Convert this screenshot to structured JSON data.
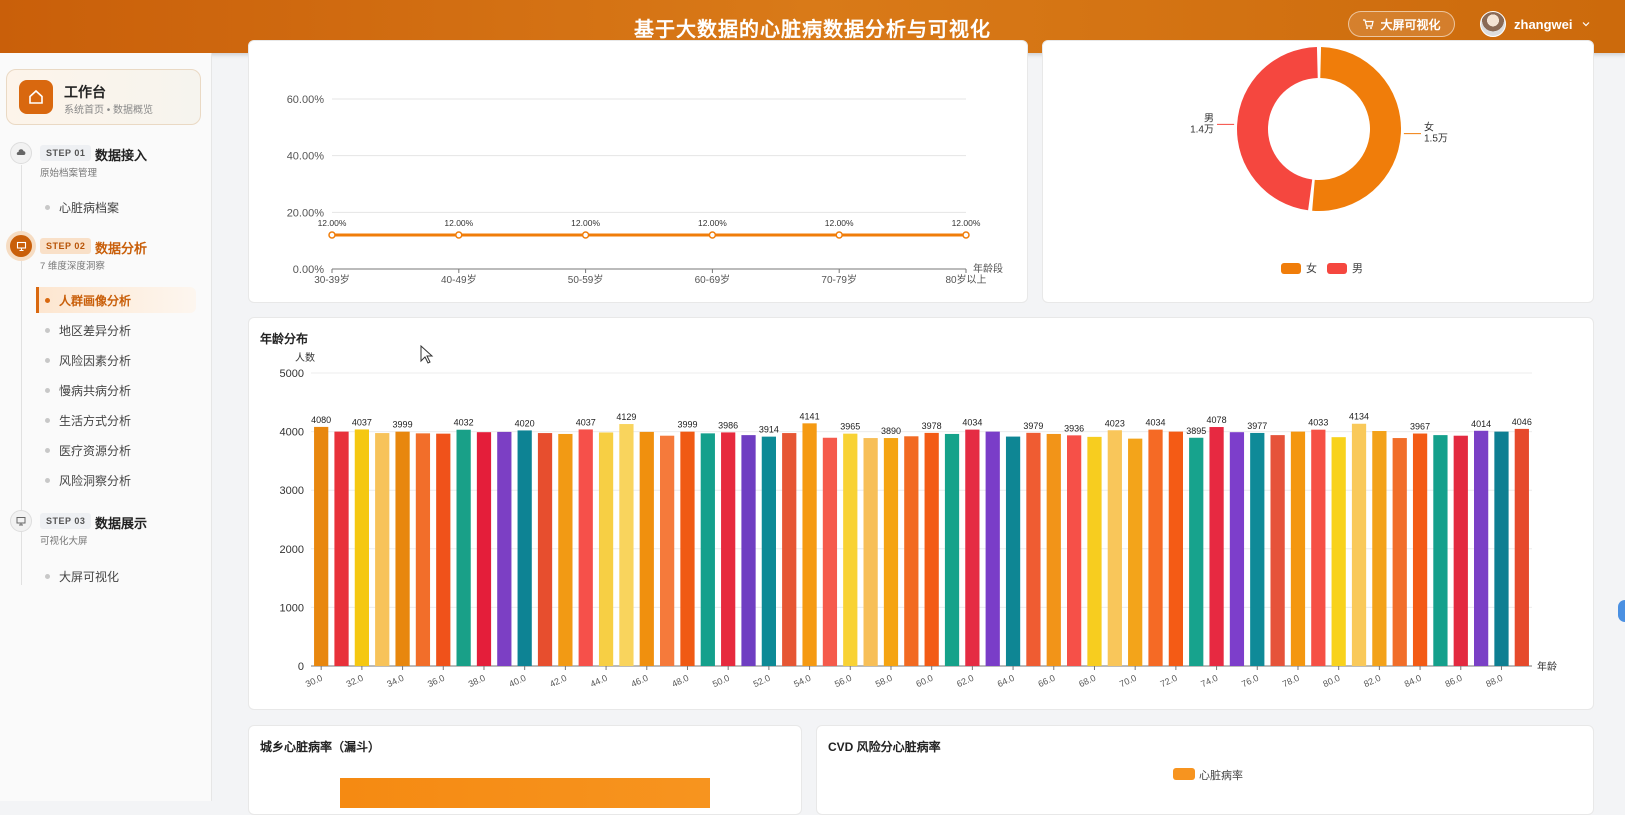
{
  "header": {
    "title": "基于大数据的心脏病数据分析与可视化",
    "bigscreen_label": "大屏可视化",
    "username": "zhangwei"
  },
  "sidebar": {
    "workbench": {
      "title": "工作台",
      "subtitle": "系统首页 • 数据概览"
    },
    "steps": [
      {
        "tag": "STEP 01",
        "name": "数据接入",
        "sub": "原始档案管理",
        "items": [
          "心脏病档案"
        ]
      },
      {
        "tag": "STEP 02",
        "name": "数据分析",
        "sub": "7 维度深度洞察",
        "items": [
          "人群画像分析",
          "地区差异分析",
          "风险因素分析",
          "慢病共病分析",
          "生活方式分析",
          "医疗资源分析",
          "风险洞察分析"
        ]
      },
      {
        "tag": "STEP 03",
        "name": "数据展示",
        "sub": "可视化大屏",
        "items": [
          "大屏可视化"
        ]
      }
    ]
  },
  "colors": {
    "accent": "#d9680f",
    "female": "#f07d0a",
    "male": "#f5473f"
  },
  "chart_data": [
    {
      "type": "line",
      "x": [
        "30-39岁",
        "40-49岁",
        "50-59岁",
        "60-69岁",
        "70-79岁",
        "80岁以上"
      ],
      "series": [
        {
          "values": [
            12.0,
            12.0,
            12.0,
            12.0,
            12.0,
            12.0
          ]
        }
      ],
      "data_labels": [
        "12.00%",
        "12.00%",
        "12.00%",
        "12.00%",
        "12.00%",
        "12.00%"
      ],
      "xlabel": "年龄段",
      "ylabel": "",
      "yticks": [
        "0.00%",
        "20.00%",
        "40.00%",
        "60.00%"
      ],
      "ylim": [
        0,
        60
      ],
      "grid": true
    },
    {
      "type": "pie",
      "donut": true,
      "labels": [
        "女",
        "男"
      ],
      "values": [
        1.5,
        1.4
      ],
      "value_labels": [
        "1.5万",
        "1.4万"
      ],
      "legend": "bottom"
    },
    {
      "type": "bar",
      "title": "年龄分布",
      "xlabel": "年龄",
      "ylabel": "人数",
      "ylim": [
        0,
        5000
      ],
      "yticks": [
        0,
        1000,
        2000,
        3000,
        4000,
        5000
      ],
      "categories": [
        "30.0",
        "31.0",
        "32.0",
        "33.0",
        "34.0",
        "35.0",
        "36.0",
        "37.0",
        "38.0",
        "39.0",
        "40.0",
        "41.0",
        "42.0",
        "43.0",
        "44.0",
        "45.0",
        "46.0",
        "47.0",
        "48.0",
        "49.0",
        "50.0",
        "51.0",
        "52.0",
        "53.0",
        "54.0",
        "55.0",
        "56.0",
        "57.0",
        "58.0",
        "59.0",
        "60.0",
        "61.0",
        "62.0",
        "63.0",
        "64.0",
        "65.0",
        "66.0",
        "67.0",
        "68.0",
        "69.0",
        "70.0",
        "71.0",
        "72.0",
        "73.0",
        "74.0",
        "75.0",
        "76.0",
        "77.0",
        "78.0",
        "79.0",
        "80.0",
        "81.0",
        "82.0",
        "83.0",
        "84.0",
        "85.0",
        "86.0",
        "87.0",
        "88.0",
        "89.0"
      ],
      "tick_labels": [
        "30.0",
        "32.0",
        "34.0",
        "36.0",
        "38.0",
        "40.0",
        "42.0",
        "44.0",
        "46.0",
        "48.0",
        "50.0",
        "52.0",
        "54.0",
        "56.0",
        "58.0",
        "60.0",
        "62.0",
        "64.0",
        "66.0",
        "68.0",
        "70.0",
        "72.0",
        "74.0",
        "76.0",
        "78.0",
        "80.0",
        "82.0",
        "84.0",
        "86.0",
        "88.0"
      ],
      "values": [
        4080,
        4000,
        4037,
        3975,
        3999,
        3970,
        3965,
        4032,
        3990,
        3995,
        4020,
        3975,
        3960,
        4037,
        3985,
        4129,
        3995,
        3930,
        3999,
        3970,
        3986,
        3940,
        3914,
        3975,
        4141,
        3895,
        3965,
        3890,
        3890,
        3920,
        3978,
        3960,
        4034,
        4000,
        3915,
        3979,
        3960,
        3936,
        3910,
        4023,
        3880,
        4034,
        4000,
        3895,
        4078,
        3990,
        3977,
        3940,
        4000,
        4033,
        3905,
        4134,
        4010,
        3890,
        3967,
        3940,
        3930,
        4014,
        4000,
        4046
      ],
      "label_values": {
        "0": 4080,
        "2": 4037,
        "4": 3999,
        "7": 4032,
        "10": 4020,
        "13": 4037,
        "15": 4129,
        "18": 3999,
        "20": 3986,
        "22": 3914,
        "24": 4141,
        "26": 3965,
        "28": 3890,
        "30": 3978,
        "32": 4034,
        "35": 3979,
        "37": 3936,
        "39": 4023,
        "41": 4034,
        "43": 3895,
        "44": 4078,
        "46": 3977,
        "49": 4033,
        "51": 4134,
        "54": 3967,
        "57": 4014,
        "59": 4046
      },
      "bar_colors": [
        "#e8870e",
        "#e8313b",
        "#f5c811",
        "#f7c35a",
        "#e8870e",
        "#f26e2a",
        "#f0521a",
        "#19a088",
        "#e41e3a",
        "#7c3fc4",
        "#0d8394",
        "#e74e2e",
        "#f29a14",
        "#f6504a",
        "#f7cf44",
        "#f9d45d",
        "#f0900e",
        "#f57a3b",
        "#f05a14",
        "#14a08c",
        "#e72a3e",
        "#6f3ec2",
        "#0d8a96",
        "#e65634",
        "#f59a12",
        "#f55a4c",
        "#f8d234",
        "#f7bf58",
        "#f5a412",
        "#f26a22",
        "#f35b15",
        "#15a28a",
        "#e52c43",
        "#7a3dc8",
        "#0e8694",
        "#ef5c32",
        "#f29418",
        "#f65048",
        "#f7cd1f",
        "#f9c65a",
        "#f3a41a",
        "#f56a25",
        "#f45b15",
        "#17a38d",
        "#e72941",
        "#7d3ecb",
        "#0f8a98",
        "#e6533a",
        "#f4970f",
        "#f65045",
        "#f8d21c",
        "#f9c95a",
        "#f3a21a",
        "#f16e2a",
        "#f35b15",
        "#14a08c",
        "#e32a40",
        "#7a40c6",
        "#0e7f92",
        "#e64a2c"
      ]
    },
    {
      "type": "bar",
      "title": "城乡心脏病率（漏斗）"
    },
    {
      "type": "bar",
      "title": "CVD 风险分心脏病率",
      "legend_entries": [
        "心脏病率"
      ]
    }
  ]
}
